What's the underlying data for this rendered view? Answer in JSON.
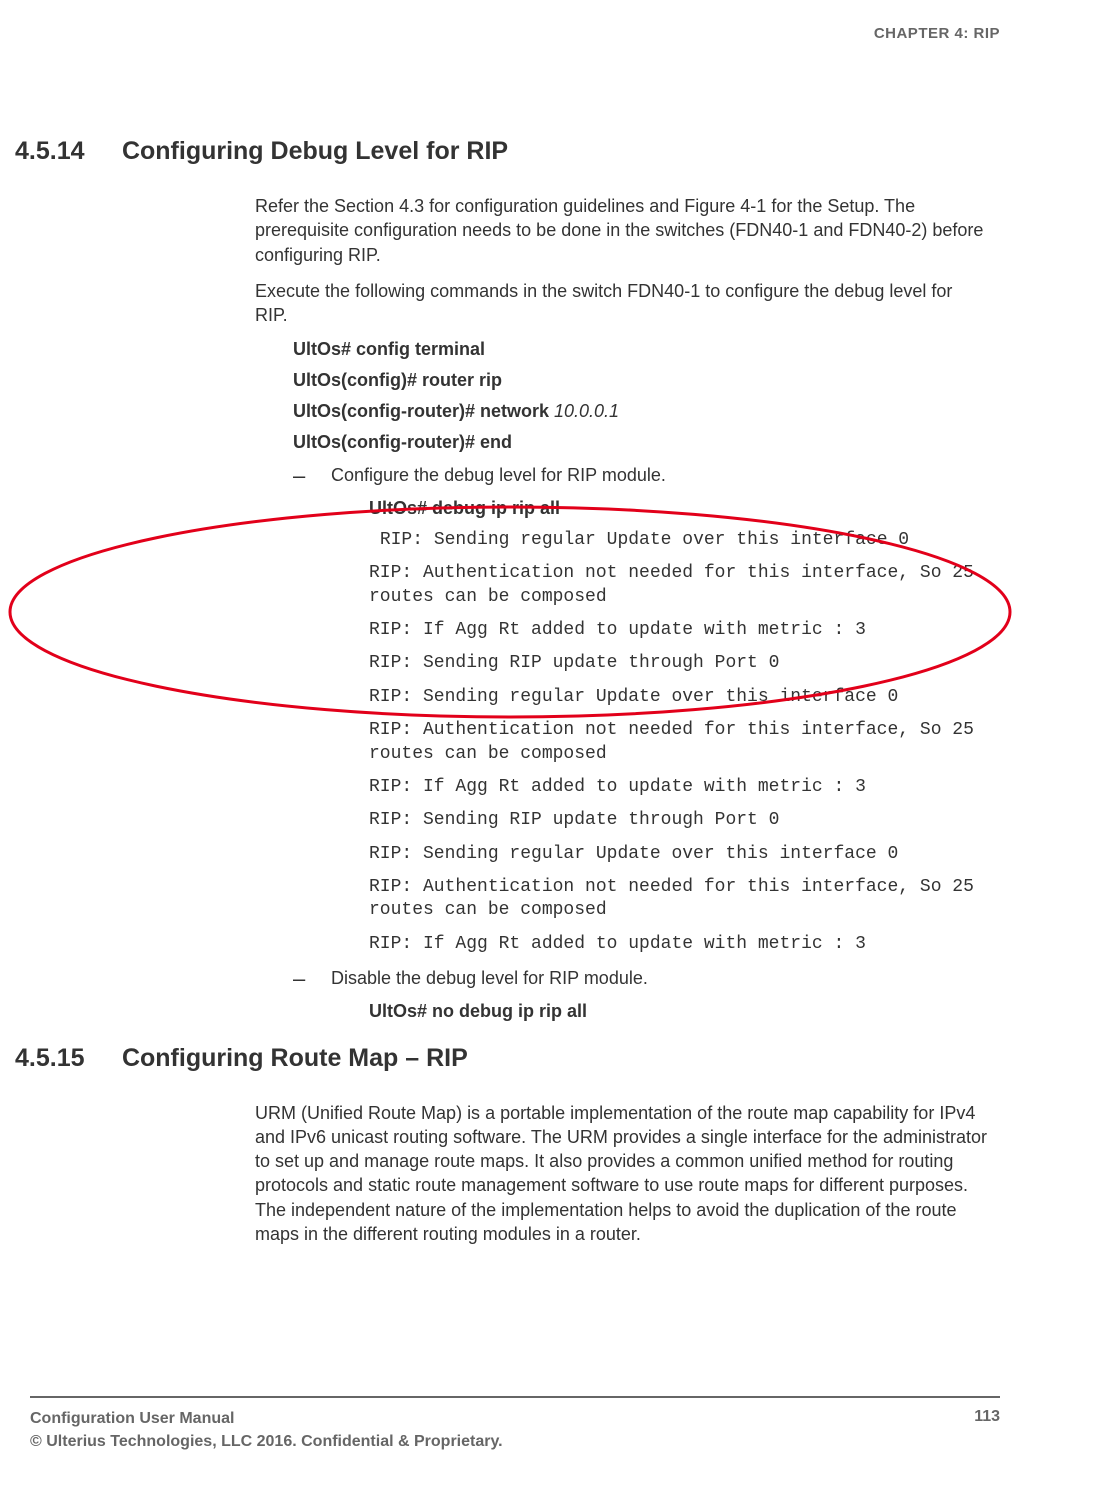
{
  "header": {
    "chapter": "CHAPTER 4: RIP"
  },
  "sections": {
    "s1": {
      "num": "4.5.14",
      "title": "Configuring Debug Level for RIP",
      "p1": "Refer the Section 4.3 for configuration guidelines and Figure 4-1 for the Setup.  The prerequisite configuration needs to be done in the switches (FDN40-1 and FDN40-2) before configuring RIP.",
      "p2": "Execute the following commands in the switch FDN40-1 to configure the debug level for RIP.",
      "cmd1": "UltOs# config terminal",
      "cmd2": "UltOs(config)# router rip",
      "cmd3_a": "UltOs(config-router)# network ",
      "cmd3_b": "10.0.0.1",
      "cmd4": "UltOs(config-router)# end",
      "bullet1": "Configure the debug level for RIP module.",
      "cmd5": "UltOs# debug ip rip all",
      "out": {
        "l1": " RIP: Sending regular Update over this interface 0",
        "l2": "RIP: Authentication not needed for this interface, So 25 routes can be composed",
        "l3": "RIP: If Agg Rt added to update with metric : 3",
        "l4": "RIP: Sending RIP update through Port 0",
        "l5": "RIP: Sending regular Update over this interface 0",
        "l6": "RIP: Authentication not needed for this interface, So 25 routes can be composed",
        "l7": "RIP: If Agg Rt added to update with metric : 3",
        "l8": "RIP: Sending RIP update through Port 0",
        "l9": "RIP: Sending regular Update over this interface 0",
        "l10": "RIP: Authentication not needed for this interface, So 25 routes can be composed",
        "l11": "RIP: If Agg Rt added to update with metric : 3"
      },
      "bullet2": "Disable the debug level for RIP module.",
      "cmd6": "UltOs# no debug ip rip all"
    },
    "s2": {
      "num": "4.5.15",
      "title": "Configuring Route Map – RIP",
      "p1": "URM (Unified Route Map) is a portable implementation of the route map capability for IPv4 and IPv6 unicast routing software. The URM provides a single interface for the administrator to set up and manage route maps. It also provides a common unified method for routing protocols and static route management software to use route maps for different purposes. The independent nature of the implementation helps to avoid the duplication of the route maps in the different routing modules in a router."
    }
  },
  "footer": {
    "l1": "Configuration User Manual",
    "l2": "© Ulterius Technologies, LLC 2016. Confidential & Proprietary.",
    "page": "113"
  }
}
